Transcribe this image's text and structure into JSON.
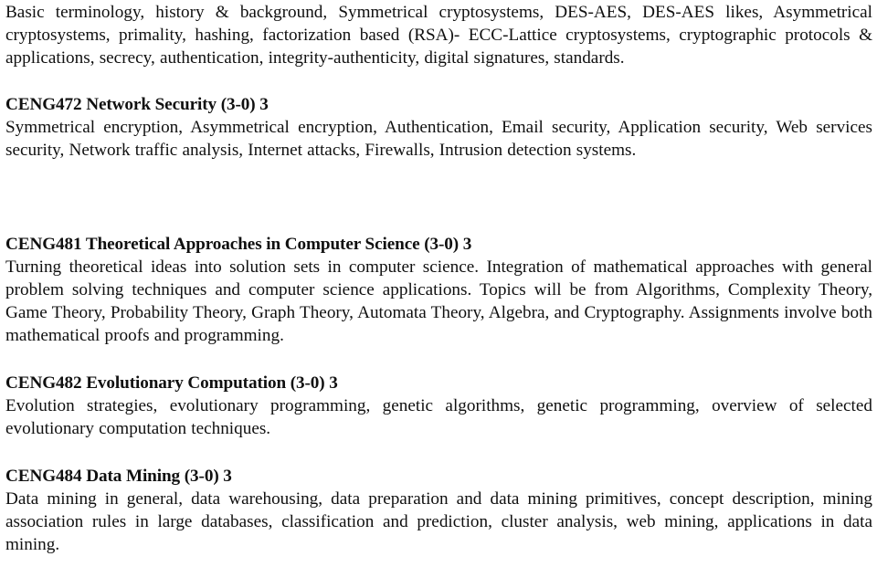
{
  "document": {
    "type": "course-catalog-page",
    "intro_paragraph": "Basic terminology, history & background, Symmetrical cryptosystems, DES-AES, DES-AES likes, Asymmetrical cryptosystems, primality, hashing, factorization based (RSA)- ECC-Lattice cryptosystems, cryptographic protocols & applications, secrecy, authentication, integrity-authenticity, digital signatures, standards.",
    "courses": [
      {
        "code": "CENG472",
        "title": "Network Security",
        "hours": "(3-0)",
        "credits": "3",
        "heading": "CENG472 Network Security (3-0) 3",
        "description": "Symmetrical encryption, Asymmetrical encryption, Authentication, Email security, Application security, Web services security, Network traffic analysis, Internet attacks, Firewalls, Intrusion detection systems."
      },
      {
        "code": "CENG481",
        "title": "Theoretical Approaches in Computer Science",
        "hours": "(3-0)",
        "credits": "3",
        "heading": "CENG481 Theoretical Approaches in Computer Science (3-0) 3",
        "description": "Turning theoretical ideas into solution sets in computer science. Integration of mathematical approaches with general problem solving techniques and computer science applications. Topics will be from Algorithms, Complexity Theory, Game Theory, Probability Theory, Graph Theory, Automata Theory, Algebra, and Cryptography. Assignments involve both mathematical proofs and programming."
      },
      {
        "code": "CENG482",
        "title": "Evolutionary Computation",
        "hours": "(3-0)",
        "credits": "3",
        "heading": "CENG482 Evolutionary Computation (3-0) 3",
        "description": "Evolution strategies, evolutionary programming, genetic algorithms, genetic programming, overview of selected evolutionary computation techniques."
      },
      {
        "code": "CENG484",
        "title": "Data Mining",
        "hours": "(3-0)",
        "credits": "3",
        "heading": "CENG484 Data Mining (3-0) 3",
        "description": "Data mining in general, data warehousing, data preparation and data mining primitives, concept description, mining association rules in large databases, classification and prediction, cluster analysis, web mining, applications in data mining."
      }
    ],
    "colors": {
      "text": "#101010",
      "background": "#ffffff"
    }
  }
}
